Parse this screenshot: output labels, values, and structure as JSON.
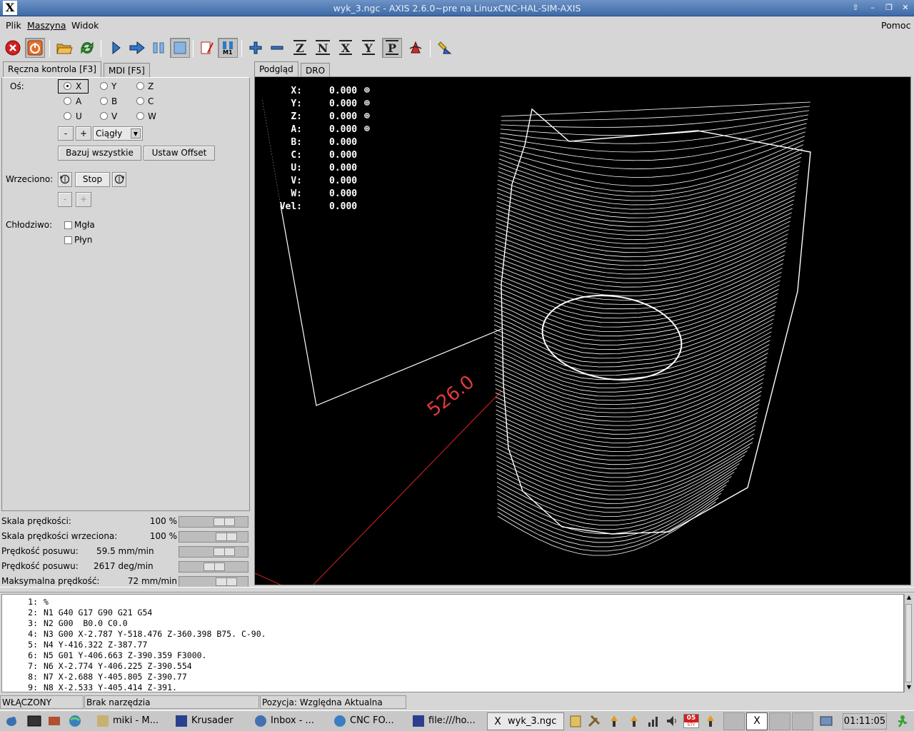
{
  "window": {
    "title": "wyk_3.ngc - AXIS 2.6.0~pre na LinuxCNC-HAL-SIM-AXIS"
  },
  "menu": {
    "items": [
      "Plik",
      "Maszyna",
      "Widok"
    ],
    "help": "Pomoc"
  },
  "toolbar": {
    "icons": [
      "estop-icon",
      "power-icon",
      "open-file-icon",
      "reload-icon",
      "run-icon",
      "step-icon",
      "pause-icon",
      "stop-icon",
      "run-from-line-icon",
      "optional-stop-icon",
      "zoom-in-icon",
      "zoom-out-icon",
      "view-z-icon",
      "view-z2-icon",
      "view-x-icon",
      "view-y-icon",
      "view-p-icon",
      "rotate-view-icon",
      "clear-plot-icon"
    ],
    "m1_label": "M1"
  },
  "left_tabs": [
    "Ręczna kontrola [F3]",
    "MDI [F5]"
  ],
  "manual": {
    "axis_label": "Oś:",
    "axes": [
      "X",
      "Y",
      "Z",
      "A",
      "B",
      "C",
      "U",
      "V",
      "W"
    ],
    "selected_axis": "X",
    "minus": "-",
    "plus": "+",
    "jog_mode": "Ciągły",
    "home_all": "Bazuj wszystkie",
    "set_offset": "Ustaw Offset",
    "spindle_label": "Wrzeciono:",
    "spindle_stop": "Stop",
    "coolant_label": "Chłodziwo:",
    "mist": "Mgła",
    "flood": "Płyn"
  },
  "sliders": [
    {
      "label": "Skala prędkości:",
      "value": "100 %",
      "fraction": 0.72
    },
    {
      "label": "Skala prędkości wrzeciona:",
      "value": "100 %",
      "fraction": 0.78
    },
    {
      "label": "Prędkość posuwu:",
      "value": "59.5 mm/min",
      "fraction": 0.72
    },
    {
      "label": "Prędkość posuwu:",
      "value": "2617 deg/min",
      "fraction": 0.52
    },
    {
      "label": "Maksymalna prędkość:",
      "value": "72 mm/min",
      "fraction": 0.78
    }
  ],
  "preview_tabs": [
    "Podgląd",
    "DRO"
  ],
  "dro": [
    {
      "axis": "X:",
      "value": "0.000",
      "homed": true
    },
    {
      "axis": "Y:",
      "value": "0.000",
      "homed": true
    },
    {
      "axis": "Z:",
      "value": "0.000",
      "homed": true
    },
    {
      "axis": "A:",
      "value": "0.000",
      "homed": true
    },
    {
      "axis": "B:",
      "value": "0.000",
      "homed": false
    },
    {
      "axis": "C:",
      "value": "0.000",
      "homed": false
    },
    {
      "axis": "U:",
      "value": "0.000",
      "homed": false
    },
    {
      "axis": "V:",
      "value": "0.000",
      "homed": false
    },
    {
      "axis": "W:",
      "value": "0.000",
      "homed": false
    },
    {
      "axis": "Vel:",
      "value": "0.000",
      "homed": false
    }
  ],
  "extent_label": "526.0",
  "gcode": [
    {
      "n": "1:",
      "code": "%"
    },
    {
      "n": "2:",
      "code": "N1 G40 G17 G90 G21 G54"
    },
    {
      "n": "3:",
      "code": "N2 G00  B0.0 C0.0"
    },
    {
      "n": "4:",
      "code": "N3 G00 X-2.787 Y-518.476 Z-360.398 B75. C-90."
    },
    {
      "n": "5:",
      "code": "N4 Y-416.322 Z-387.77"
    },
    {
      "n": "6:",
      "code": "N5 G01 Y-406.663 Z-390.359 F3000."
    },
    {
      "n": "7:",
      "code": "N6 X-2.774 Y-406.225 Z-390.554"
    },
    {
      "n": "8:",
      "code": "N7 X-2.688 Y-405.805 Z-390.77"
    },
    {
      "n": "9:",
      "code": "N8 X-2.533 Y-405.414 Z-391."
    }
  ],
  "status": {
    "state": "WŁĄCZONY",
    "tool": "Brak narzędzia",
    "position": "Pozycja: Względna Aktualna"
  },
  "taskbar": {
    "tasks": [
      "miki - M...",
      "Krusader",
      "Inbox - ...",
      "CNC FO...",
      "file:///ho...",
      "wyk_3.ngc"
    ],
    "calendar_day": "05",
    "calendar_month": "STY",
    "clock": "01:11:05"
  }
}
